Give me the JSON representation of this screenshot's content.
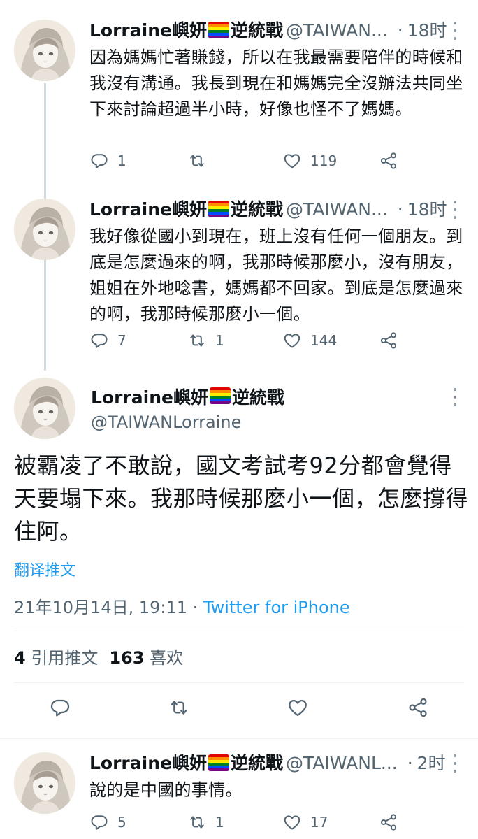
{
  "tweets": [
    {
      "name": "Lorraine嶼妍",
      "name_suffix": "逆統戰",
      "handle": "@TAIWAN...",
      "dot": "·",
      "time": "18时",
      "text": "因為媽媽忙著賺錢，所以在我最需要陪伴的時候和我沒有溝通。我長到現在和媽媽完全沒辦法共同坐下來討論超過半小時，好像也怪不了媽媽。",
      "replies": "1",
      "retweets": "",
      "likes": "119"
    },
    {
      "name": "Lorraine嶼妍",
      "name_suffix": "逆統戰",
      "handle": "@TAIWAN...",
      "dot": "·",
      "time": "18时",
      "text": "我好像從國小到現在，班上沒有任何一個朋友。到底是怎麼過來的啊，我那時候那麼小，沒有朋友，姐姐在外地唸書，媽媽都不回家。到底是怎麼過來的啊，我那時候那麼小一個。",
      "replies": "7",
      "retweets": "1",
      "likes": "144"
    }
  ],
  "main_tweet": {
    "name": "Lorraine嶼妍",
    "name_suffix": "逆統戰",
    "handle": "@TAIWANLorraine",
    "text": "被霸凌了不敢說，國文考試考92分都會覺得天要塌下來。我那時候那麼小一個，怎麼撐得住阿。",
    "translate_label": "翻译推文",
    "date": "21年10月14日, 19:11",
    "meta_dot": " · ",
    "source": "Twitter for iPhone",
    "quote_count": "4",
    "quote_label": "引用推文",
    "like_count": "163",
    "like_label": "喜欢"
  },
  "reply_tweet": {
    "name": "Lorraine嶼妍",
    "name_suffix": "逆統戰",
    "handle": "@TAIWANL...",
    "dot": "·",
    "time": "2时",
    "text": "說的是中國的事情。",
    "replies": "5",
    "retweets": "1",
    "likes": "17"
  },
  "colors": {
    "text": "#0f1419",
    "secondary": "#536471",
    "link": "#1d9bf0",
    "thread_line": "#cfd9de"
  },
  "icons": [
    "reply-icon",
    "retweet-icon",
    "like-icon",
    "share-icon",
    "more-icon",
    "rainbow-flag-icon"
  ]
}
